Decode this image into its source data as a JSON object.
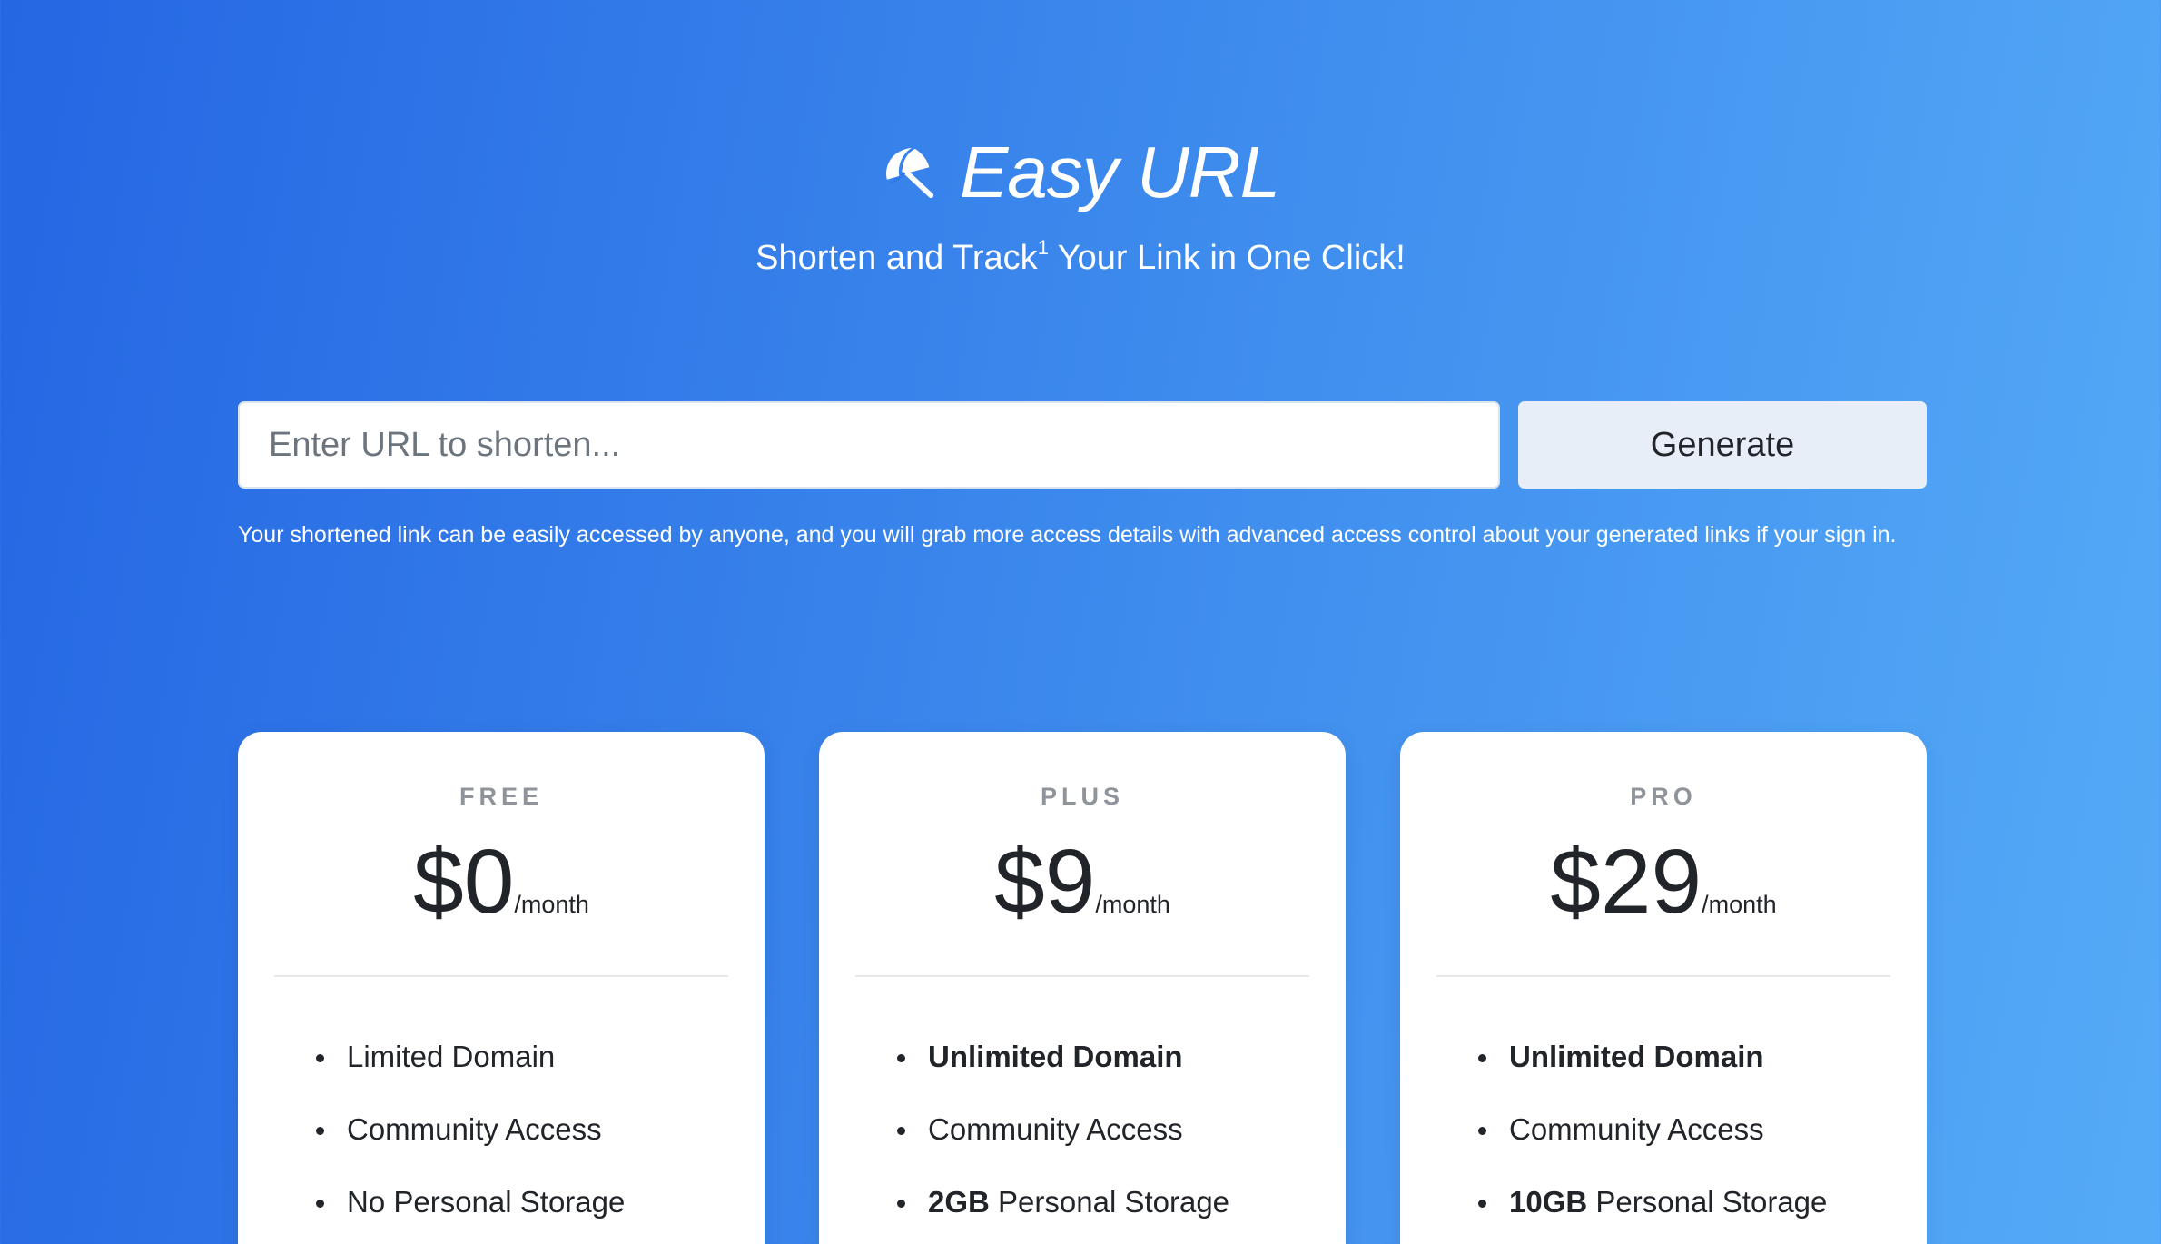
{
  "header": {
    "logo_icon": "umbrella-icon",
    "title": "Easy URL",
    "tagline_start": "Shorten and Track",
    "tagline_sup": "1",
    "tagline_end": " Your Link in One Click!"
  },
  "form": {
    "placeholder": "Enter URL to shorten...",
    "value": "",
    "button_label": "Generate",
    "helper_text": "Your shortened link can be easily accessed by anyone, and you will grab more access details with advanced access control about your generated links if your sign in."
  },
  "plans": [
    {
      "name": "FREE",
      "price": "$0",
      "period": "/month",
      "features": [
        {
          "bold": "",
          "text": "Limited Domain"
        },
        {
          "bold": "",
          "text": "Community Access"
        },
        {
          "bold": "",
          "text": "No Personal Storage"
        }
      ]
    },
    {
      "name": "PLUS",
      "price": "$9",
      "period": "/month",
      "features": [
        {
          "bold": "Unlimited Domain",
          "text": ""
        },
        {
          "bold": "",
          "text": "Community Access"
        },
        {
          "bold": "2GB",
          "text": " Personal Storage"
        }
      ]
    },
    {
      "name": "PRO",
      "price": "$29",
      "period": "/month",
      "features": [
        {
          "bold": "Unlimited Domain",
          "text": ""
        },
        {
          "bold": "",
          "text": "Community Access"
        },
        {
          "bold": "10GB",
          "text": " Personal Storage"
        }
      ]
    }
  ],
  "colors": {
    "gradient_start": "#2566e3",
    "gradient_end": "#55abf7",
    "card_bg": "#ffffff",
    "button_bg": "#e7eef8",
    "muted_text": "#8e949a"
  }
}
